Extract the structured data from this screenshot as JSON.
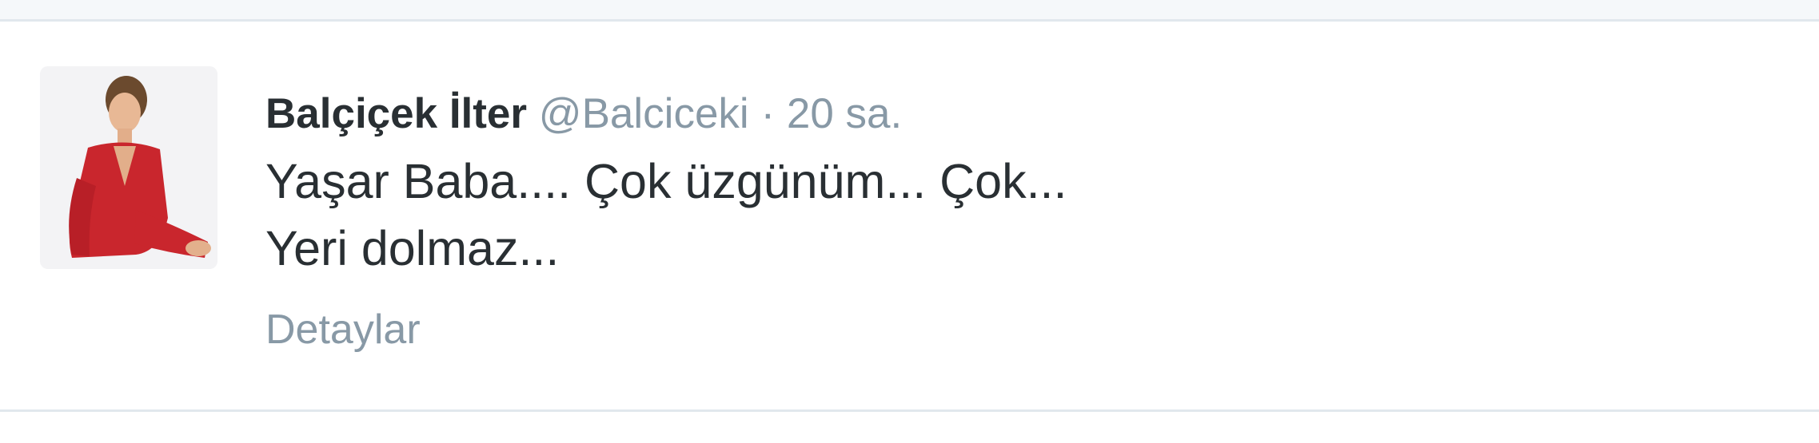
{
  "tweet": {
    "author": {
      "name": "Balçiçek İlter",
      "handle": "@Balciceki"
    },
    "separator": "·",
    "time": "20 sa.",
    "text_lines": [
      "Yaşar Baba.... Çok üzgünüm... Çok...",
      "Yeri dolmaz..."
    ],
    "details_label": "Detaylar"
  },
  "colors": {
    "name": "#292f33",
    "meta": "#8899a6",
    "divider": "#e1e8ed",
    "background_strip": "#f5f8fa"
  },
  "icons": {
    "avatar": "profile-photo"
  }
}
